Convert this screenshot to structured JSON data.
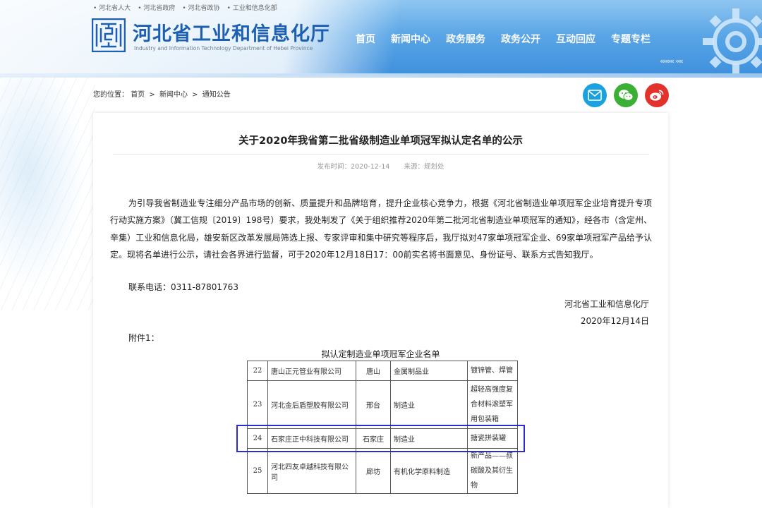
{
  "top_links": [
    "河北省人大",
    "河北省政府",
    "河北省政协",
    "工业和信息化部"
  ],
  "site": {
    "title": "河北省工业和信息化厅",
    "subtitle": "Industry and Information Technology Department of Hebei Province"
  },
  "nav": [
    "首页",
    "新闻中心",
    "政务服务",
    "政务公开",
    "互动回应",
    "专题专栏"
  ],
  "breadcrumb": {
    "prefix": "您的位置：",
    "items": [
      "首页",
      "新闻中心",
      "通知公告"
    ],
    "separator": ">"
  },
  "share_icons": [
    "email-icon",
    "wechat-icon",
    "weibo-icon"
  ],
  "colors": {
    "nav_bg": "#3d8fdc",
    "brand": "#1c5fb3",
    "highlight": "#2a2ccf",
    "email": "#1aa1e0",
    "wechat": "#3cb034",
    "weibo": "#e2322b"
  },
  "article": {
    "title": "关于2020年我省第二批省级制造业单项冠军拟认定名单的公示",
    "publish_label": "发布时间：2020-12-14",
    "source_label": "来源：规划处",
    "body": "为引导我省制造业专注细分产品市场的创新、质量提升和品牌培育，提升企业核心竞争力，根据《河北省制造业单项冠军企业培育提升专项行动实施方案》（冀工信规〔2019〕198号）要求，我处制发了《关于组织推荐2020年第二批河北省制造业单项冠军的通知》，经各市（含定州、辛集）工业和信息化局，雄安新区改革发展局筛选上报、专家评审和集中研究等程序后，我厅拟对47家单项冠军企业、69家单项冠军产品给予认定。现将名单进行公示，请社会各界进行监督，可于2020年12月18日17：00前实名将书面意见、身份证号、联系方式告知我厅。",
    "contact": "联系电话：0311-87801763",
    "signature_org": "河北省工业和信息化厅",
    "signature_date": "2020年12月14日",
    "attachment_label": "附件1：",
    "table_caption": "拟认定制造业单项冠军企业名单"
  },
  "table": {
    "rows": [
      {
        "no": "22",
        "name": "唐山正元管业有限公司",
        "city": "唐山",
        "industry": "金属制品业",
        "product": "镀锌管、焊管"
      },
      {
        "no": "23",
        "name": "河北金后盾塑胶有限公司",
        "city": "邢台",
        "industry": "制造业",
        "product": "超轻高强度复合材料滚塑军用包装箱"
      },
      {
        "no": "24",
        "name": "石家庄正中科技有限公司",
        "city": "石家庄",
        "industry": "制造业",
        "product": "搪瓷拼装罐"
      },
      {
        "no": "25",
        "name": "河北四友卓越科技有限公司",
        "city": "廊坊",
        "industry": "有机化学原料制造",
        "product": "新产品——叔碳酸及其衍生物"
      }
    ]
  }
}
